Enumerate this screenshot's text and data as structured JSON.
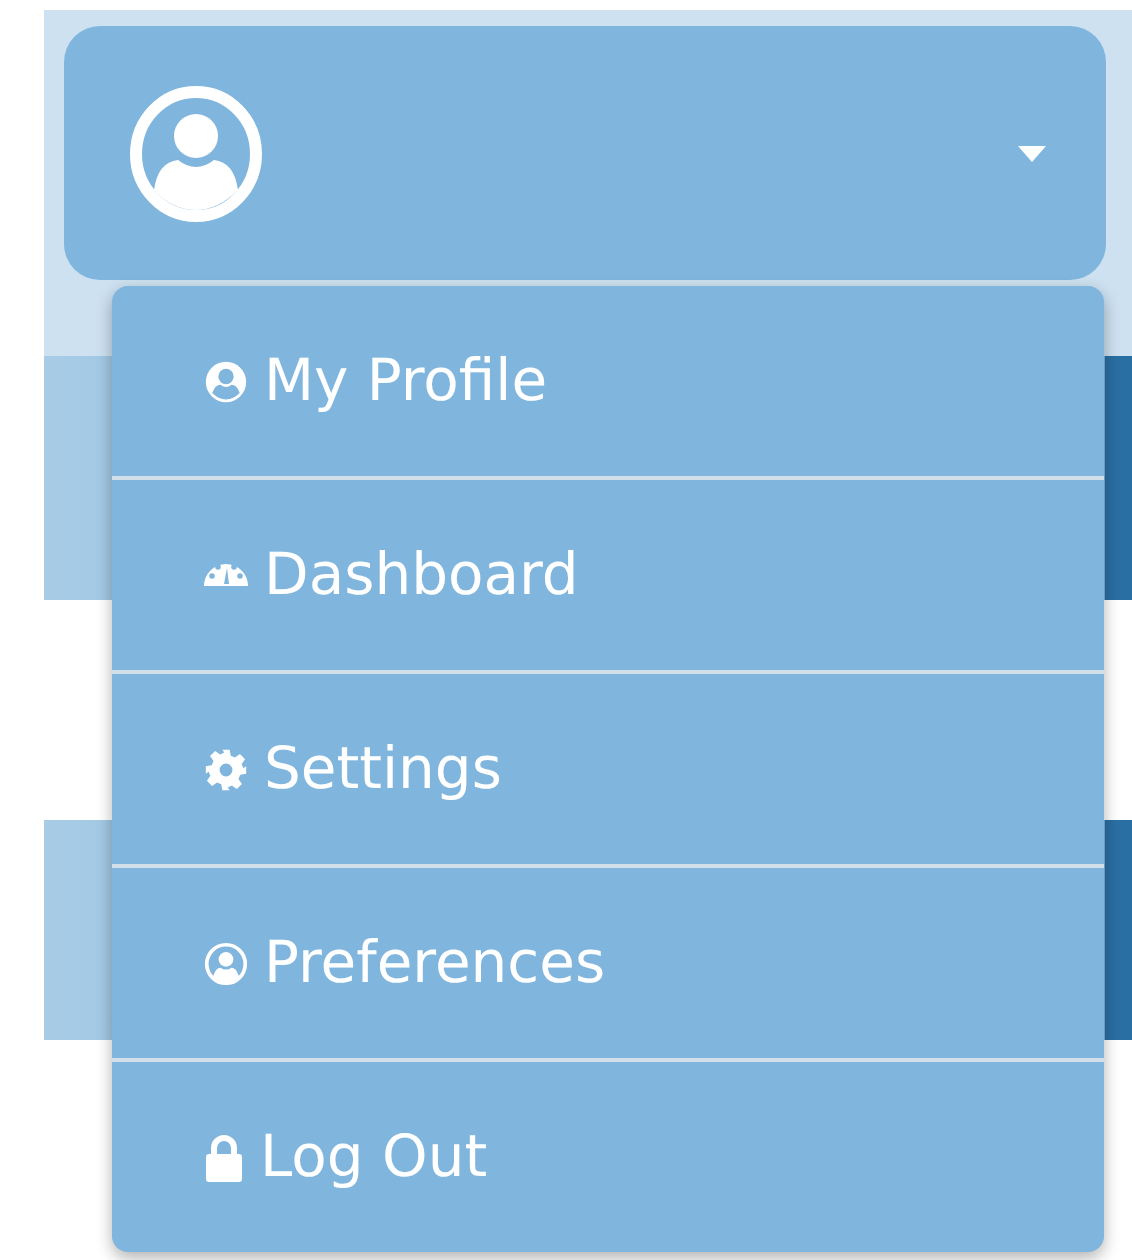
{
  "user_menu": {
    "expanded": true
  },
  "menu_items": [
    {
      "label": "My Profile",
      "kind": "profile"
    },
    {
      "label": "Dashboard",
      "kind": "dashboard"
    },
    {
      "label": "Settings",
      "kind": "settings"
    },
    {
      "label": "Preferences",
      "kind": "preferences"
    },
    {
      "label": "Log Out",
      "kind": "logout"
    }
  ]
}
